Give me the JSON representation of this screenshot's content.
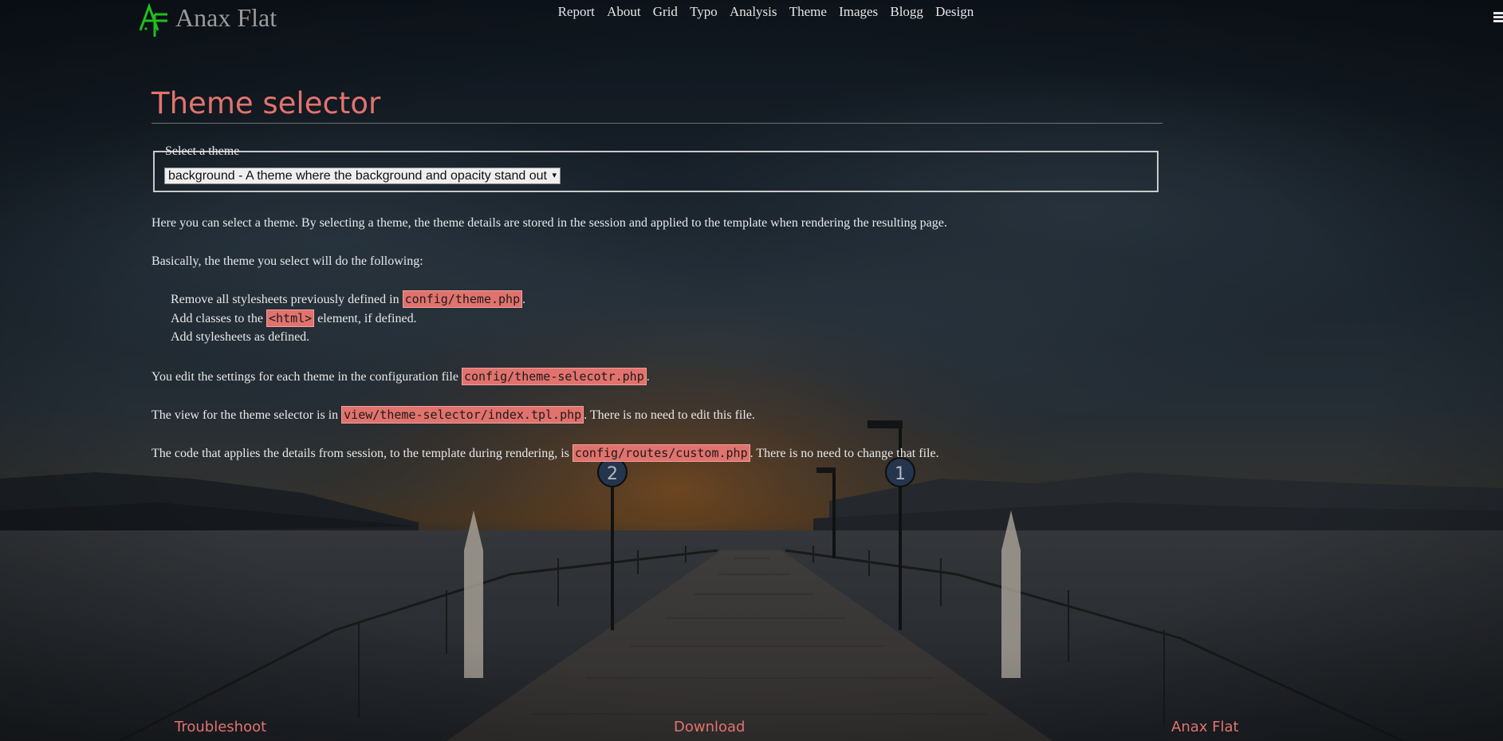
{
  "site": {
    "title": "Anax Flat",
    "logo_icon": "anax-flat-logo-icon",
    "logo_color": "#1fbf1f"
  },
  "nav": {
    "items": [
      "Report",
      "About",
      "Grid",
      "Typo",
      "Analysis",
      "Theme",
      "Images",
      "Blogg",
      "Design"
    ],
    "menu_icon": "hamburger-menu-icon"
  },
  "page": {
    "title": "Theme selector",
    "accent_color": "#e27370"
  },
  "theme_form": {
    "legend": "Select a theme",
    "selected_value": "background - A theme where the background and opacity stand out",
    "arrow": "▾"
  },
  "content": {
    "intro": "Here you can select a theme. By selecting a theme, the theme details are stored in the session and applied to the template when rendering the resulting page.",
    "basically": "Basically, the theme you select will do the following:",
    "list": [
      {
        "before": "Remove all stylesheets previously defined in ",
        "code": "config/theme.php",
        "after": "."
      },
      {
        "before": "Add classes to the ",
        "code": "<html>",
        "after": " element, if defined."
      },
      {
        "before": "Add stylesheets as defined.",
        "code": "",
        "after": ""
      }
    ],
    "edit": {
      "before": "You edit the settings for each theme in the configuration file ",
      "code": "config/theme-selecotr.php",
      "after": "."
    },
    "view": {
      "before": "The view for the theme selector is in ",
      "code": "view/theme-selector/index.tpl.php",
      "after": ". There is no need to edit this file."
    },
    "code_applies": {
      "before": "The code that applies the details from session, to the template during rendering, is ",
      "code": "config/routes/custom.php",
      "after": ". There is no need to change that file."
    }
  },
  "footer": {
    "links": [
      "Troubleshoot",
      "Download",
      "Anax Flat"
    ]
  }
}
